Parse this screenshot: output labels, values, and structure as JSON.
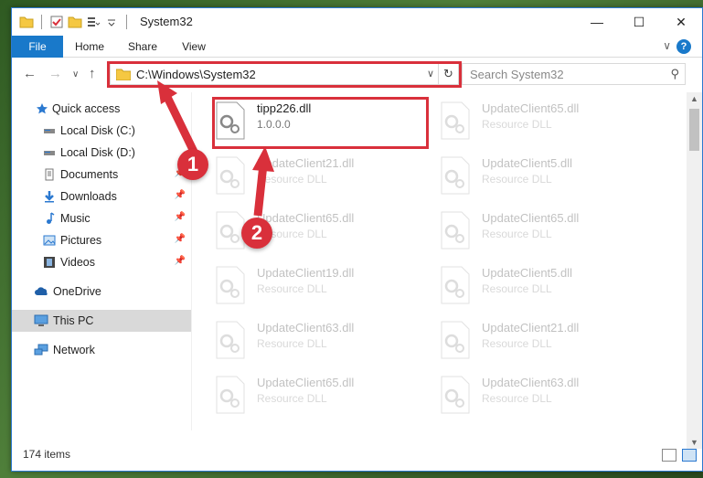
{
  "window": {
    "title": "System32",
    "controls": [
      "minimize-icon",
      "maximize-icon",
      "close-icon"
    ]
  },
  "ribbon": {
    "tabs": [
      {
        "label": "File",
        "active": true
      },
      {
        "label": "Home"
      },
      {
        "label": "Share"
      },
      {
        "label": "View"
      }
    ],
    "help": "?"
  },
  "navbar": {
    "path": "C:\\Windows\\System32",
    "search_placeholder": "Search System32"
  },
  "sidebar": {
    "items": [
      {
        "label": "Quick access",
        "icon": "star-icon",
        "pinned": false
      },
      {
        "label": "Local Disk (C:)",
        "icon": "drive-icon",
        "pinned": false
      },
      {
        "label": "Local Disk (D:)",
        "icon": "drive-icon",
        "pinned": false
      },
      {
        "label": "Documents",
        "icon": "documents-icon",
        "pinned": true
      },
      {
        "label": "Downloads",
        "icon": "downloads-icon",
        "pinned": true
      },
      {
        "label": "Music",
        "icon": "music-icon",
        "pinned": true
      },
      {
        "label": "Pictures",
        "icon": "pictures-icon",
        "pinned": true
      },
      {
        "label": "Videos",
        "icon": "videos-icon",
        "pinned": true
      },
      {
        "label": "OneDrive",
        "icon": "cloud-icon",
        "pinned": false
      },
      {
        "label": "This PC",
        "icon": "computer-icon",
        "pinned": false,
        "selected": true
      },
      {
        "label": "Network",
        "icon": "network-icon",
        "pinned": false
      }
    ]
  },
  "files": [
    {
      "name": "tipp226.dll",
      "sub": "1.0.0.0",
      "active": true
    },
    {
      "name": "UpdateClient65.dll",
      "sub": "Resource DLL"
    },
    {
      "name": "UpdateClient21.dll",
      "sub": "Resource DLL"
    },
    {
      "name": "UpdateClient5.dll",
      "sub": "Resource DLL"
    },
    {
      "name": "UpdateClient65.dll",
      "sub": "Resource DLL"
    },
    {
      "name": "UpdateClient65.dll",
      "sub": "Resource DLL"
    },
    {
      "name": "UpdateClient19.dll",
      "sub": "Resource DLL"
    },
    {
      "name": "UpdateClient5.dll",
      "sub": "Resource DLL"
    },
    {
      "name": "UpdateClient63.dll",
      "sub": "Resource DLL"
    },
    {
      "name": "UpdateClient21.dll",
      "sub": "Resource DLL"
    },
    {
      "name": "UpdateClient65.dll",
      "sub": "Resource DLL"
    },
    {
      "name": "UpdateClient63.dll",
      "sub": "Resource DLL"
    }
  ],
  "status": {
    "count": "174 items"
  },
  "callouts": [
    "1",
    "2"
  ],
  "colors": {
    "accent": "#1979ca",
    "highlight": "#d9303b"
  }
}
